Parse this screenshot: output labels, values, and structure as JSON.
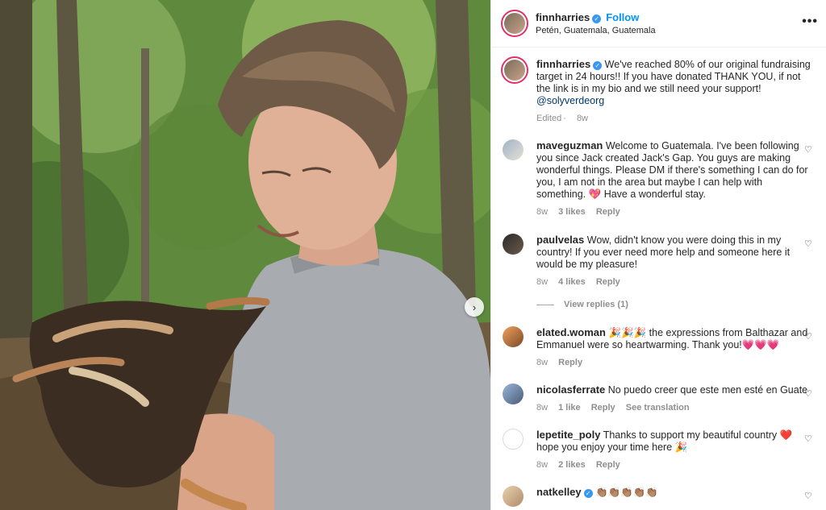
{
  "post": {
    "username": "finnharries",
    "follow_label": "Follow",
    "location": "Petén, Guatemala, Guatemala",
    "more_icon": "more-options-icon",
    "caption": {
      "text": "We've reached 80% of our original fundraising target in 24 hours!! If you have donated THANK YOU, if not the link is in my bio and we still need your support!",
      "mention": "@solyverdeorg",
      "edited": "Edited",
      "time": "8w"
    }
  },
  "comments": [
    {
      "username": "maveguzman",
      "text": "Welcome to Guatemala. I've been following you since Jack created Jack's Gap. You guys are making wonderful things. Please DM if there's something I can do for you, I am not in the area but maybe I can help with something.",
      "emoji": "💖",
      "text_after": "Have a wonderful stay.",
      "time": "8w",
      "likes": "3 likes",
      "reply": "Reply"
    },
    {
      "username": "paulvelas",
      "text": "Wow, didn't know you were doing this in my country! If you ever need more help and someone here it would be my pleasure!",
      "time": "8w",
      "likes": "4 likes",
      "reply": "Reply",
      "view_replies": "View replies (1)"
    },
    {
      "username": "elated.woman",
      "emoji_lead": "🎉🎉🎉",
      "text": "the expressions from Balthazar and Emmanuel were so heartwarming. Thank you!",
      "emoji": "💗💗💗",
      "time": "8w",
      "reply": "Reply"
    },
    {
      "username": "nicolasferrate",
      "text": "No puedo creer que este men esté en Guate",
      "time": "8w",
      "likes": "1 like",
      "reply": "Reply",
      "translation": "See translation"
    },
    {
      "username": "lepetite_poly",
      "text": "Thanks to support my beautiful country",
      "emoji": "❤️",
      "text_after": "hope you enjoy your time here",
      "emoji_after": "🎉",
      "time": "8w",
      "likes": "2 likes",
      "reply": "Reply"
    },
    {
      "username": "natkelley",
      "emoji": "👏🏽👏🏽👏🏽👏🏽👏🏽"
    }
  ],
  "colors": {
    "accent": "#0095f6",
    "verified": "#3897f0",
    "story_ring": "#e1306c",
    "muted": "#8e8e8e"
  }
}
